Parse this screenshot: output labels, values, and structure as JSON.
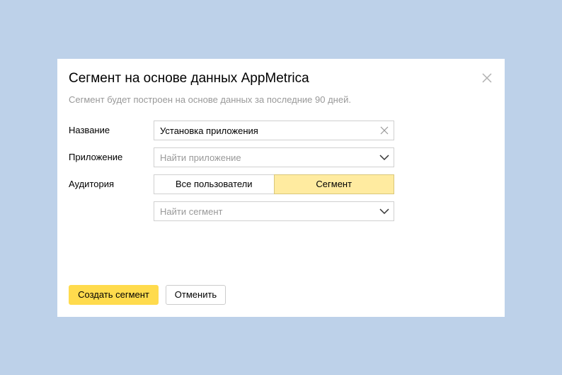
{
  "modal": {
    "title": "Сегмент на основе данных AppMetrica",
    "subtitle": "Сегмент будет построен на основе данных за последние 90 дней.",
    "close_icon": "close-icon"
  },
  "form": {
    "name": {
      "label": "Название",
      "value": "Установка приложения",
      "clear_icon": "clear-icon"
    },
    "app": {
      "label": "Приложение",
      "placeholder": "Найти приложение",
      "icon": "chevron-down-icon"
    },
    "audience": {
      "label": "Аудитория",
      "options": [
        "Все пользователи",
        "Сегмент"
      ],
      "selected": "Сегмент"
    },
    "segment": {
      "placeholder": "Найти сегмент",
      "icon": "chevron-down-icon"
    }
  },
  "actions": {
    "create_label": "Создать сегмент",
    "cancel_label": "Отменить"
  },
  "colors": {
    "background": "#bdd1e9",
    "primary": "#ffdb4d",
    "selected": "#ffeba0"
  }
}
